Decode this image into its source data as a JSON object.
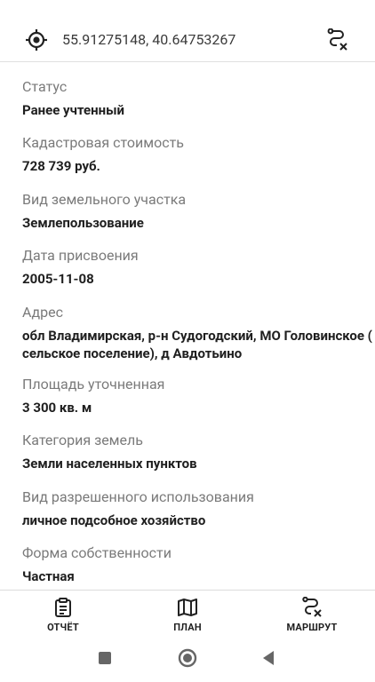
{
  "header": {
    "coordinates": "55.91275148, 40.64753267",
    "icons": {
      "left": "location-target-icon",
      "right": "route-cancel-icon"
    }
  },
  "fields": [
    {
      "label": "Статус",
      "value": "Ранее учтенный"
    },
    {
      "label": "Кадастровая стоимость",
      "value": "728 739 руб."
    },
    {
      "label": "Вид земельного участка",
      "value": "Землепользование"
    },
    {
      "label": "Дата присвоения",
      "value": "2005-11-08"
    },
    {
      "label": "Адрес",
      "value": "обл Владимирская, р-н Судогодский, МО Головинское ( сельское поселение), д Авдотьино"
    },
    {
      "label": "Площадь уточненная",
      "value": "3 300 кв. м"
    },
    {
      "label": "Категория земель",
      "value": "Земли населенных пунктов"
    },
    {
      "label": "Вид разрешенного использования",
      "value": "личное подсобное хозяйство"
    },
    {
      "label": "Форма собственности",
      "value": "Частная"
    }
  ],
  "bottom_nav": [
    {
      "label": "ОТЧЁТ",
      "icon": "clipboard-icon"
    },
    {
      "label": "ПЛАН",
      "icon": "map-icon"
    },
    {
      "label": "МАРШРУТ",
      "icon": "route-cancel-icon"
    }
  ],
  "system_nav": {
    "icons": [
      "recent-apps-icon",
      "home-icon",
      "back-icon"
    ]
  },
  "colors": {
    "label": "#7a7a7a",
    "value": "#1f1f1f",
    "divider": "#e0e0e0"
  }
}
